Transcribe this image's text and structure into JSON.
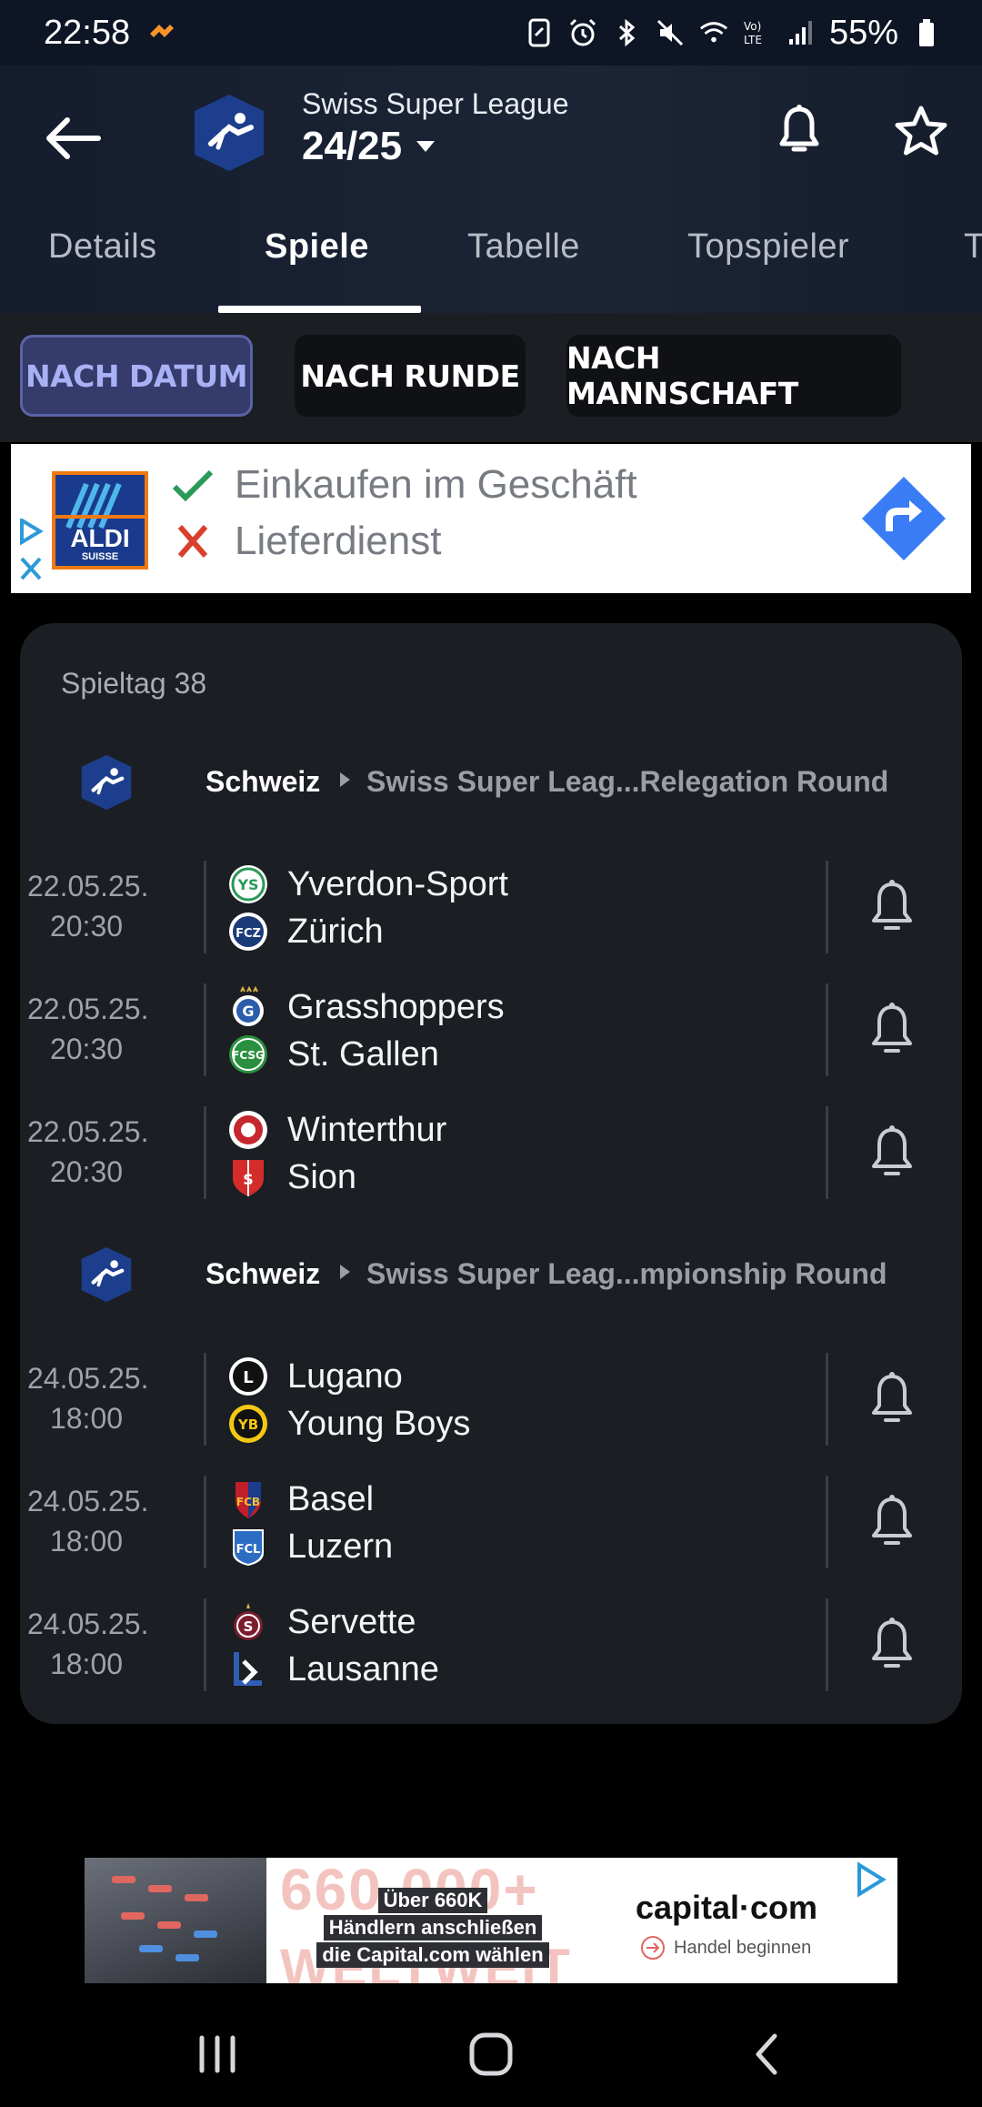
{
  "status_bar": {
    "time": "22:58",
    "battery": "55%"
  },
  "header": {
    "league_name": "Swiss Super League",
    "season": "24/25",
    "tabs": [
      {
        "label": "Details"
      },
      {
        "label": "Spiele"
      },
      {
        "label": "Tabelle"
      },
      {
        "label": "Topspieler"
      },
      {
        "label": "T"
      }
    ],
    "active_tab": "Spiele"
  },
  "filters": [
    {
      "label": "NACH DATUM",
      "active": true
    },
    {
      "label": "NACH RUNDE",
      "active": false
    },
    {
      "label": "NACH MANNSCHAFT",
      "active": false
    }
  ],
  "ad_top": {
    "brand": "ALDI",
    "brand_sub": "SUISSE",
    "line_yes": "Einkaufen im Geschäft",
    "line_no": "Lieferdienst"
  },
  "games": {
    "round_label": "Spieltag 38",
    "groups": [
      {
        "country": "Schweiz",
        "competition": "Swiss Super Leag...Relegation Round",
        "matches": [
          {
            "date": "22.05.25.",
            "time": "20:30",
            "home": "Yverdon-Sport",
            "away": "Zürich"
          },
          {
            "date": "22.05.25.",
            "time": "20:30",
            "home": "Grasshoppers",
            "away": "St. Gallen"
          },
          {
            "date": "22.05.25.",
            "time": "20:30",
            "home": "Winterthur",
            "away": "Sion"
          }
        ]
      },
      {
        "country": "Schweiz",
        "competition": "Swiss Super Leag...mpionship Round",
        "matches": [
          {
            "date": "24.05.25.",
            "time": "18:00",
            "home": "Lugano",
            "away": "Young Boys"
          },
          {
            "date": "24.05.25.",
            "time": "18:00",
            "home": "Basel",
            "away": "Luzern"
          },
          {
            "date": "24.05.25.",
            "time": "18:00",
            "home": "Servette",
            "away": "Lausanne"
          }
        ]
      }
    ]
  },
  "ad_bottom": {
    "watermark_top": "660.000+",
    "watermark_bottom": "WELTWEIT",
    "text_lines": [
      "Über 660K",
      "Händlern anschließen",
      "die Capital.com wählen"
    ],
    "brand": "capital·com",
    "cta": "Handel beginnen"
  },
  "colors": {
    "header_bg": "#1c2535",
    "card_bg": "#1b1e23",
    "chip_active_bg": "#353b6a",
    "chip_active_text": "#a9b1f5",
    "ad_blue": "#3a7cf5"
  }
}
